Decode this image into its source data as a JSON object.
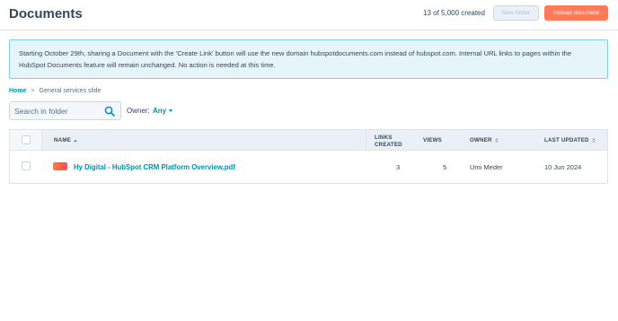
{
  "header": {
    "title": "Documents",
    "count_text": "13 of 5,000 created",
    "new_folder_label": "New folder",
    "upload_label": "Upload document"
  },
  "alert": {
    "text": "Starting October 29th, sharing a Document with the 'Create Link' button will use the new domain hubspotdocuments.com instead of hubspot.com. Internal URL links to pages within the HubSpot Documents feature will remain unchanged. No action is needed at this time."
  },
  "breadcrumb": {
    "home": "Home",
    "separator": ">",
    "current": "General services slide"
  },
  "search": {
    "placeholder": "Search in folder",
    "value": ""
  },
  "filter": {
    "owner_label": "Owner:",
    "owner_value": "Any"
  },
  "table": {
    "columns": {
      "name": "NAME",
      "links_created_line1": "LINKS",
      "links_created_line2": "CREATED",
      "views": "VIEWS",
      "owner": "OWNER",
      "last_updated": "LAST UPDATED"
    },
    "rows": [
      {
        "name": "Hy Digital - HubSpot CRM Platform Overview.pdf",
        "links_created": "3",
        "views": "5",
        "owner": "Umi Meder",
        "last_updated": "10 Jun 2024",
        "icon": "pdf-file-icon"
      }
    ]
  },
  "colors": {
    "accent": "#0091ae",
    "primary_button": "#ff7a59",
    "alert_bg": "#e5f5f8",
    "text": "#33475b"
  }
}
